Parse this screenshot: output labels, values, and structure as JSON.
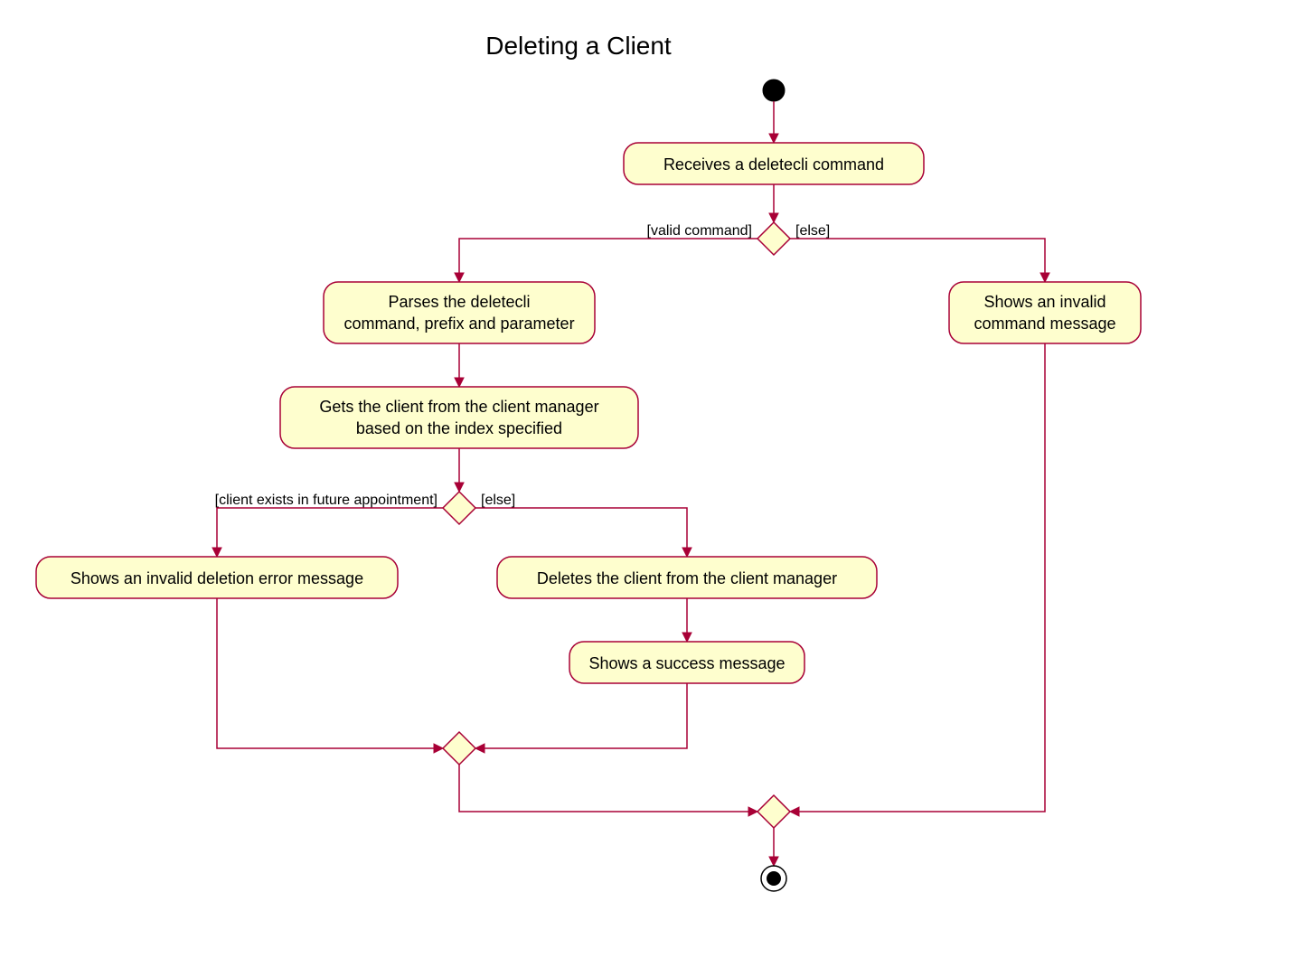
{
  "title": "Deleting a Client",
  "nodes": {
    "receive": "Receives a deletecli command",
    "parse_l1": "Parses the deletecli",
    "parse_l2": "command, prefix and parameter",
    "get_l1": "Gets the client from the client manager",
    "get_l2": "based on the index specified",
    "invalid_deletion": "Shows an invalid deletion error message",
    "delete_client": "Deletes the client from the client manager",
    "success": "Shows a success message",
    "invalid_cmd_l1": "Shows an invalid",
    "invalid_cmd_l2": "command message"
  },
  "guards": {
    "valid_cmd": "[valid command]",
    "else1": "[else]",
    "client_exists": "[client exists in future appointment]",
    "else2": "[else]"
  }
}
